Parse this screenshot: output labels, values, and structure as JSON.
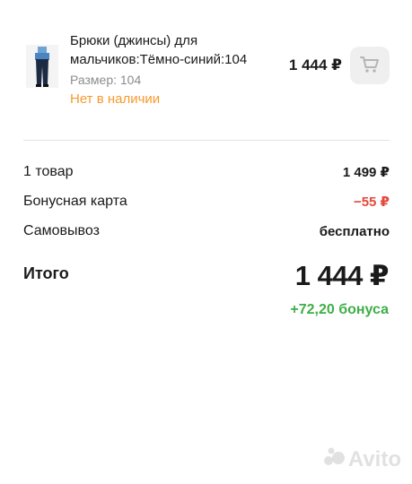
{
  "product": {
    "title": "Брюки (джинсы) для мальчиков:Тёмно-синий:104",
    "size": "Размер: 104",
    "availability": "Нет в наличии",
    "price": "1 444 ₽",
    "icon": "shopping-cart-icon"
  },
  "summary": {
    "rows": [
      {
        "label": "1 товар",
        "value": "1 499 ₽"
      },
      {
        "label": "Бонусная карта",
        "value": "−55 ₽"
      },
      {
        "label": "Самовывоз",
        "value": "бесплатно"
      }
    ],
    "total_label": "Итого",
    "total_value": "1 444 ₽",
    "bonus": "+72,20 бонуса"
  },
  "watermark": {
    "text": "Avito"
  },
  "colors": {
    "availability": "#f79a2f",
    "discount": "#e5483a",
    "bonus": "#3fae48",
    "cart_button_bg": "#efefef"
  }
}
